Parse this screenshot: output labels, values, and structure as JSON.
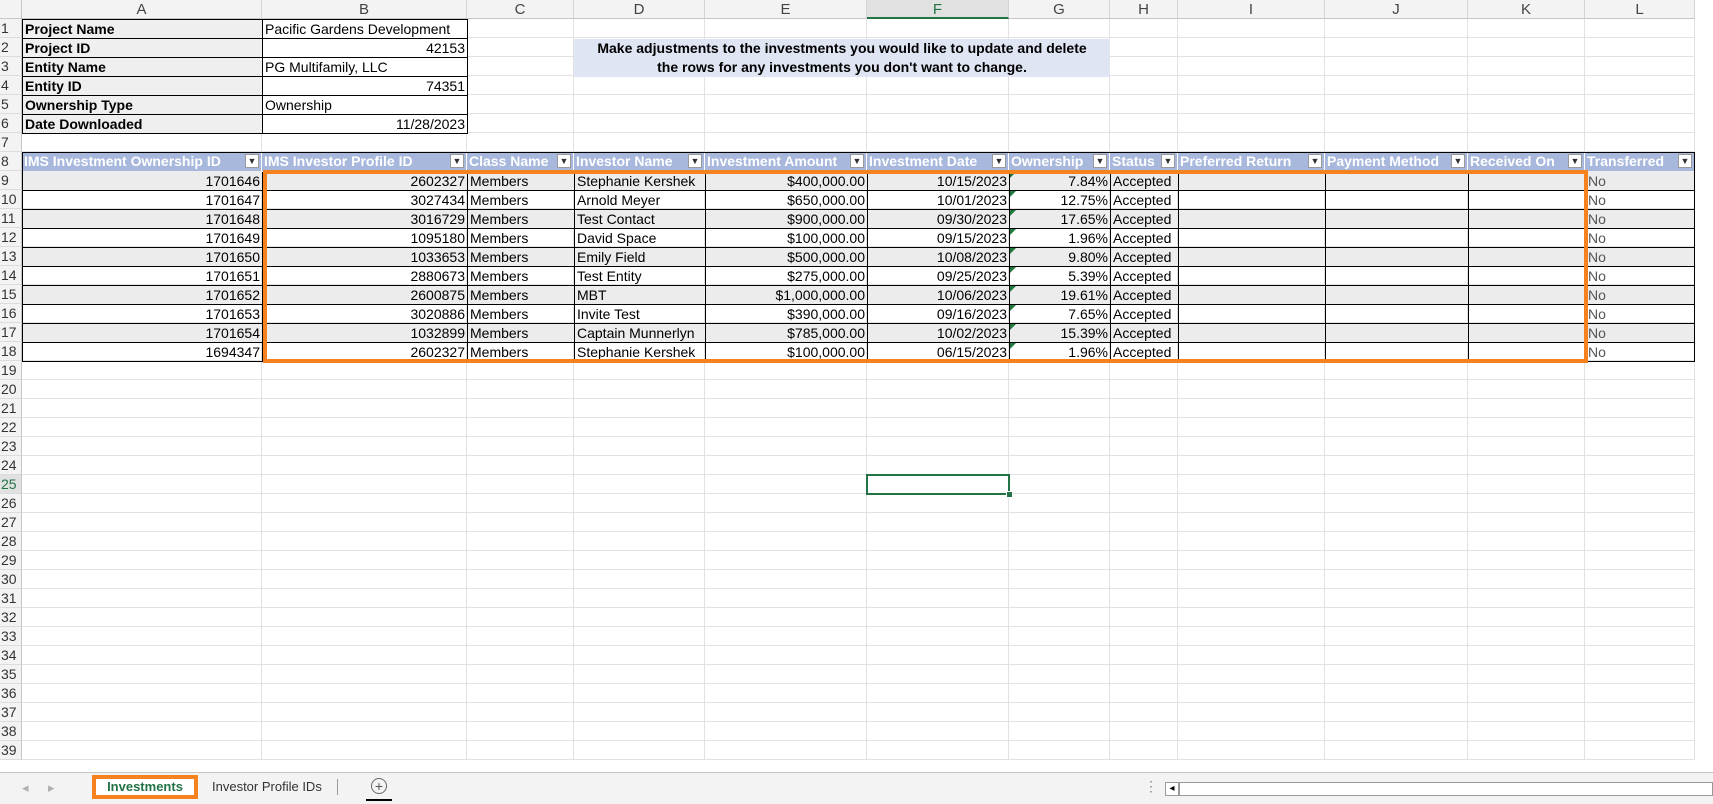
{
  "columns": [
    "A",
    "B",
    "C",
    "D",
    "E",
    "F",
    "G",
    "H",
    "I",
    "J",
    "K",
    "L"
  ],
  "active_column": "F",
  "active_row": "25",
  "row_numbers": [
    "1",
    "2",
    "3",
    "4",
    "5",
    "6",
    "7",
    "8",
    "9",
    "10",
    "11",
    "12",
    "13",
    "14",
    "15",
    "16",
    "17",
    "18",
    "19",
    "20",
    "21",
    "22",
    "23",
    "24",
    "25",
    "26",
    "27",
    "28",
    "29",
    "30",
    "31",
    "32",
    "33",
    "34",
    "35",
    "36",
    "37",
    "38",
    "39"
  ],
  "project_info": [
    {
      "label": "Project Name",
      "value": "Pacific Gardens Development",
      "align": "left"
    },
    {
      "label": "Project ID",
      "value": "42153",
      "align": "right"
    },
    {
      "label": "Entity Name",
      "value": "PG Multifamily, LLC",
      "align": "left"
    },
    {
      "label": "Entity ID",
      "value": "74351",
      "align": "right"
    },
    {
      "label": "Ownership Type",
      "value": "Ownership",
      "align": "left"
    },
    {
      "label": "Date Downloaded",
      "value": "11/28/2023",
      "align": "right"
    }
  ],
  "note_lines": [
    "Make adjustments to the investments you would like to update and delete",
    "the rows for any investments you don't want to change."
  ],
  "table_headers": [
    "IMS Investment Ownership ID",
    "IMS Investor Profile ID",
    "Class Name",
    "Investor Name",
    "Investment Amount",
    "Investment Date",
    "Ownership",
    "Status",
    "Preferred Return",
    "Payment Method",
    "Received On",
    "Transferred"
  ],
  "table_rows": [
    [
      "1701646",
      "2602327",
      "Members",
      "Stephanie Kershek",
      "$400,000.00",
      "10/15/2023",
      "7.84%",
      "Accepted",
      "",
      "",
      "",
      "No"
    ],
    [
      "1701647",
      "3027434",
      "Members",
      "Arnold Meyer",
      "$650,000.00",
      "10/01/2023",
      "12.75%",
      "Accepted",
      "",
      "",
      "",
      "No"
    ],
    [
      "1701648",
      "3016729",
      "Members",
      "Test Contact",
      "$900,000.00",
      "09/30/2023",
      "17.65%",
      "Accepted",
      "",
      "",
      "",
      "No"
    ],
    [
      "1701649",
      "1095180",
      "Members",
      "David Space",
      "$100,000.00",
      "09/15/2023",
      "1.96%",
      "Accepted",
      "",
      "",
      "",
      "No"
    ],
    [
      "1701650",
      "1033653",
      "Members",
      "Emily Field",
      "$500,000.00",
      "10/08/2023",
      "9.80%",
      "Accepted",
      "",
      "",
      "",
      "No"
    ],
    [
      "1701651",
      "2880673",
      "Members",
      "Test Entity",
      "$275,000.00",
      "09/25/2023",
      "5.39%",
      "Accepted",
      "",
      "",
      "",
      "No"
    ],
    [
      "1701652",
      "2600875",
      "Members",
      "MBT",
      "$1,000,000.00",
      "10/06/2023",
      "19.61%",
      "Accepted",
      "",
      "",
      "",
      "No"
    ],
    [
      "1701653",
      "3020886",
      "Members",
      "Invite Test",
      "$390,000.00",
      "09/16/2023",
      "7.65%",
      "Accepted",
      "",
      "",
      "",
      "No"
    ],
    [
      "1701654",
      "1032899",
      "Members",
      "Captain Munnerlyn",
      "$785,000.00",
      "10/02/2023",
      "15.39%",
      "Accepted",
      "",
      "",
      "",
      "No"
    ],
    [
      "1694347",
      "2602327",
      "Members",
      "Stephanie Kershek",
      "$100,000.00",
      "06/15/2023",
      "1.96%",
      "Accepted",
      "",
      "",
      "",
      "No"
    ]
  ],
  "sheet_tabs": [
    {
      "label": "Investments",
      "active": true
    },
    {
      "label": "Investor Profile IDs",
      "active": false
    }
  ],
  "add_sheet_symbol": "+",
  "colors": {
    "header_fill": "#a7b8dc",
    "band_fill": "#ececec",
    "highlight_outline": "#f5821f",
    "accent_green": "#217346",
    "note_fill": "#dfe5f3"
  }
}
